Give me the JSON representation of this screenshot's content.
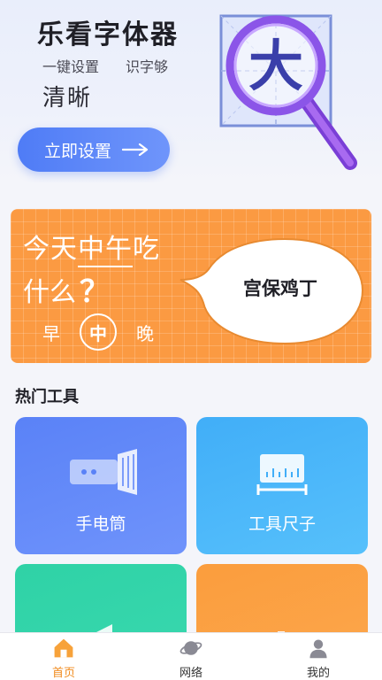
{
  "hero": {
    "title": "乐看字体器",
    "subtitle_a": "一键设置",
    "subtitle_b": "识字够",
    "subtitle_c": "清晰",
    "button_label": "立即设置",
    "art_char": "大"
  },
  "banner": {
    "line1_pre": "今天",
    "line1_highlight": "中午",
    "line1_post": "吃",
    "line2": "什么",
    "line2_mark": "？",
    "meals": [
      "早",
      "中",
      "晚"
    ],
    "answer": "宫保鸡丁"
  },
  "tools": {
    "section_title": "热门工具",
    "items": [
      {
        "label": "手电筒",
        "icon": "flashlight-icon"
      },
      {
        "label": "工具尺子",
        "icon": "ruler-icon"
      },
      {
        "label": "",
        "icon": "speaker-icon"
      },
      {
        "label": "",
        "icon": "bar-chart-icon"
      }
    ]
  },
  "nav": {
    "items": [
      {
        "label": "首页",
        "icon": "home-icon",
        "active": true
      },
      {
        "label": "网络",
        "icon": "planet-icon",
        "active": false
      },
      {
        "label": "我的",
        "icon": "user-icon",
        "active": false
      }
    ]
  },
  "colors": {
    "accent_blue": "#4f7cf6",
    "banner_orange": "#fb9a42",
    "nav_active": "#f08a1c"
  }
}
